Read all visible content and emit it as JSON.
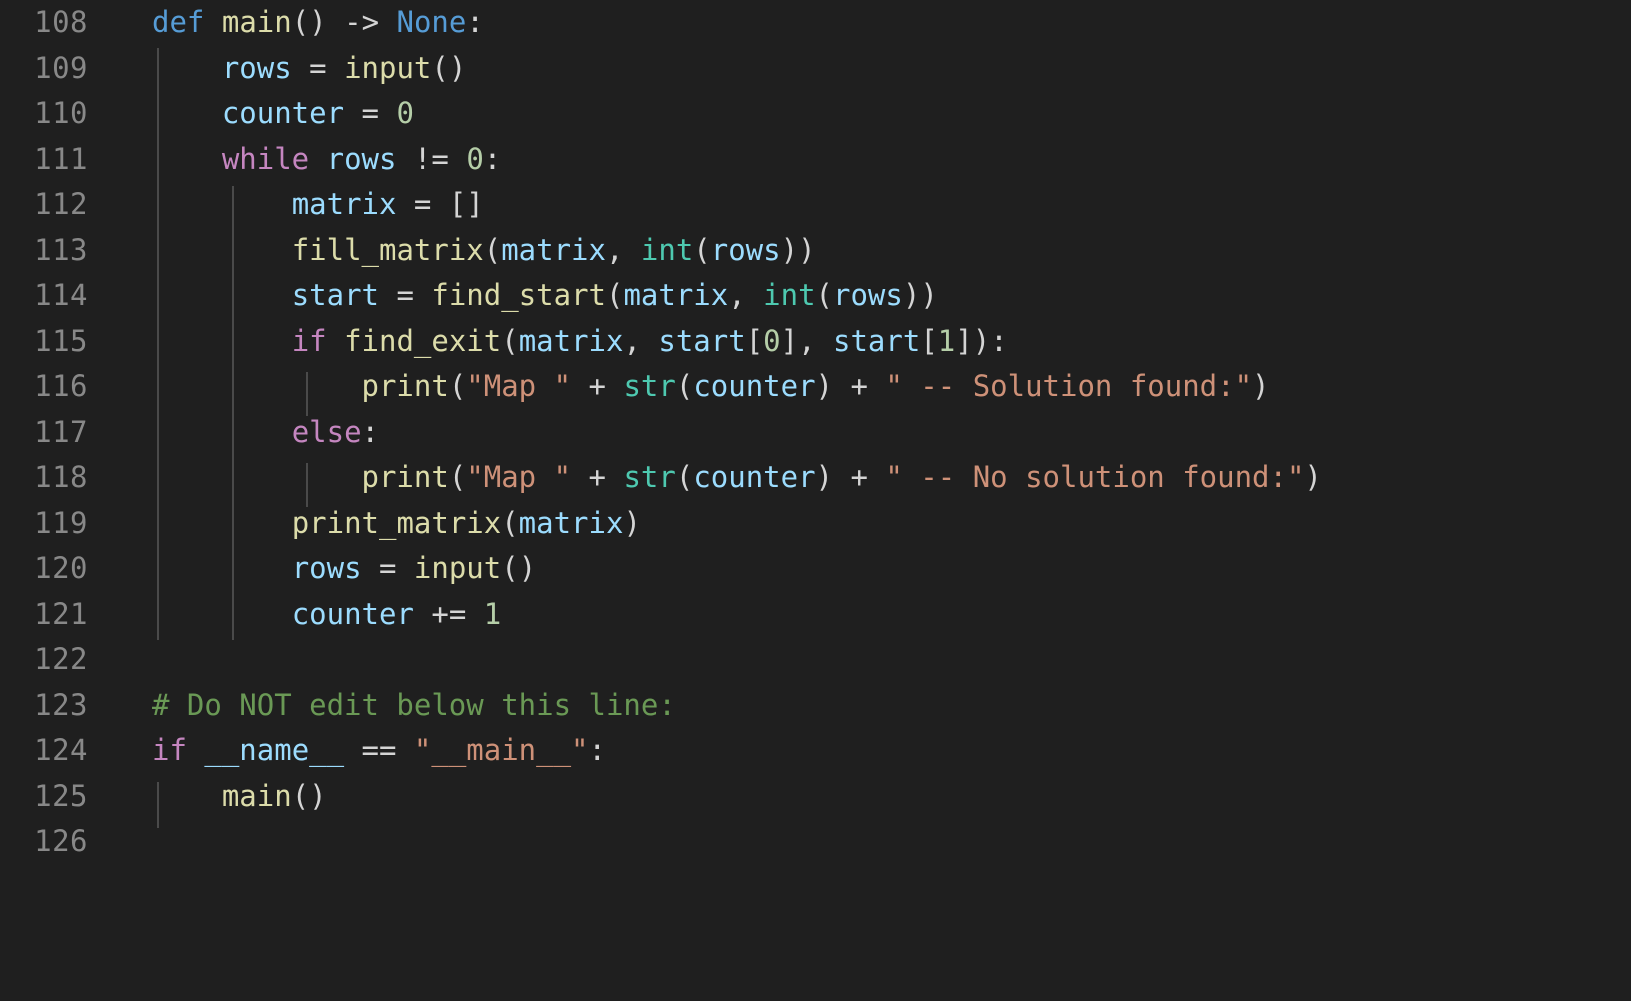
{
  "editor": {
    "language": "python",
    "background_color": "#1f1f1f",
    "line_number_color": "#888888",
    "indent_guide_color": "#4a4a4a",
    "first_visible_line": 108,
    "last_visible_line": 126,
    "theme_colors": {
      "keyword_control": "#c586c0",
      "keyword_declaration": "#569cd6",
      "function": "#dcdcaa",
      "variable": "#9cdcfe",
      "builtin_type": "#4ec9b0",
      "string": "#ce9178",
      "number": "#b5cea8",
      "comment": "#6a9955",
      "operator": "#d4d4d4"
    }
  },
  "lines": [
    {
      "number": "108",
      "text": "def main() -> None:"
    },
    {
      "number": "109",
      "text": "    rows = input()"
    },
    {
      "number": "110",
      "text": "    counter = 0"
    },
    {
      "number": "111",
      "text": "    while rows != 0:"
    },
    {
      "number": "112",
      "text": "        matrix = []"
    },
    {
      "number": "113",
      "text": "        fill_matrix(matrix, int(rows))"
    },
    {
      "number": "114",
      "text": "        start = find_start(matrix, int(rows))"
    },
    {
      "number": "115",
      "text": "        if find_exit(matrix, start[0], start[1]):"
    },
    {
      "number": "116",
      "text": "            print(\"Map \" + str(counter) + \" -- Solution found:\")"
    },
    {
      "number": "117",
      "text": "        else:"
    },
    {
      "number": "118",
      "text": "            print(\"Map \" + str(counter) + \" -- No solution found:\")"
    },
    {
      "number": "119",
      "text": "        print_matrix(matrix)"
    },
    {
      "number": "120",
      "text": "        rows = input()"
    },
    {
      "number": "121",
      "text": "        counter += 1"
    },
    {
      "number": "122",
      "text": ""
    },
    {
      "number": "123",
      "text": "# Do NOT edit below this line:"
    },
    {
      "number": "124",
      "text": "if __name__ == \"__main__\":"
    },
    {
      "number": "125",
      "text": "    main()"
    },
    {
      "number": "126",
      "text": ""
    }
  ],
  "line_numbers": {
    "l108": "108",
    "l109": "109",
    "l110": "110",
    "l111": "111",
    "l112": "112",
    "l113": "113",
    "l114": "114",
    "l115": "115",
    "l116": "116",
    "l117": "117",
    "l118": "118",
    "l119": "119",
    "l120": "120",
    "l121": "121",
    "l122": "122",
    "l123": "123",
    "l124": "124",
    "l125": "125",
    "l126": "126"
  },
  "tokens": {
    "t108": {
      "kw_def": "def",
      "sp1": " ",
      "fn_main": "main",
      "paren_open": "(",
      "paren_close": ")",
      "sp2": " ",
      "arrow": "->",
      "sp3": " ",
      "none": "None",
      "colon": ":"
    },
    "t109": {
      "indent": "    ",
      "var_rows": "rows",
      "eq": " = ",
      "fn_input": "input",
      "parens": "()"
    },
    "t110": {
      "indent": "    ",
      "var_counter": "counter",
      "eq": " = ",
      "num_zero": "0"
    },
    "t111": {
      "indent": "    ",
      "kw_while": "while",
      "sp": " ",
      "var_rows": "rows",
      "neq": " != ",
      "num_zero": "0",
      "colon": ":"
    },
    "t112": {
      "indent": "        ",
      "var_matrix": "matrix",
      "eq": " = ",
      "brackets": "[]"
    },
    "t113": {
      "indent": "        ",
      "fn_fill": "fill_matrix",
      "open": "(",
      "var_matrix": "matrix",
      "comma": ", ",
      "builtin_int": "int",
      "open2": "(",
      "var_rows": "rows",
      "close": "))"
    },
    "t114": {
      "indent": "        ",
      "var_start": "start",
      "eq": " = ",
      "fn_find_start": "find_start",
      "open": "(",
      "var_matrix": "matrix",
      "comma": ", ",
      "builtin_int": "int",
      "open2": "(",
      "var_rows": "rows",
      "close": "))"
    },
    "t115": {
      "indent": "        ",
      "kw_if": "if",
      "sp": " ",
      "fn_find_exit": "find_exit",
      "open": "(",
      "var_matrix": "matrix",
      "comma1": ", ",
      "var_start1": "start",
      "idx1_open": "[",
      "num0": "0",
      "idx1_close": "]",
      "comma2": ", ",
      "var_start2": "start",
      "idx2_open": "[",
      "num1": "1",
      "idx2_close": "]",
      "close": ")",
      "colon": ":"
    },
    "t116": {
      "indent": "            ",
      "fn_print": "print",
      "open": "(",
      "str1": "\"Map \"",
      "plus1": " + ",
      "builtin_str": "str",
      "open2": "(",
      "var_counter": "counter",
      "close2": ")",
      "plus2": " + ",
      "str2": "\" -- Solution found:\"",
      "close": ")"
    },
    "t117": {
      "indent": "        ",
      "kw_else": "else",
      "colon": ":"
    },
    "t118": {
      "indent": "            ",
      "fn_print": "print",
      "open": "(",
      "str1": "\"Map \"",
      "plus1": " + ",
      "builtin_str": "str",
      "open2": "(",
      "var_counter": "counter",
      "close2": ")",
      "plus2": " + ",
      "str2": "\" -- No solution found:\"",
      "close": ")"
    },
    "t119": {
      "indent": "        ",
      "fn_print_matrix": "print_matrix",
      "open": "(",
      "var_matrix": "matrix",
      "close": ")"
    },
    "t120": {
      "indent": "        ",
      "var_rows": "rows",
      "eq": " = ",
      "fn_input": "input",
      "parens": "()"
    },
    "t121": {
      "indent": "        ",
      "var_counter": "counter",
      "plusassign": " += ",
      "num_one": "1"
    },
    "t123": {
      "comment": "# Do NOT edit below this line:"
    },
    "t124": {
      "kw_if": "if",
      "sp": " ",
      "var_name": "__name__",
      "eqeq": " == ",
      "str_main": "\"__main__\"",
      "colon": ":"
    },
    "t125": {
      "indent": "    ",
      "fn_main": "main",
      "parens": "()"
    }
  }
}
